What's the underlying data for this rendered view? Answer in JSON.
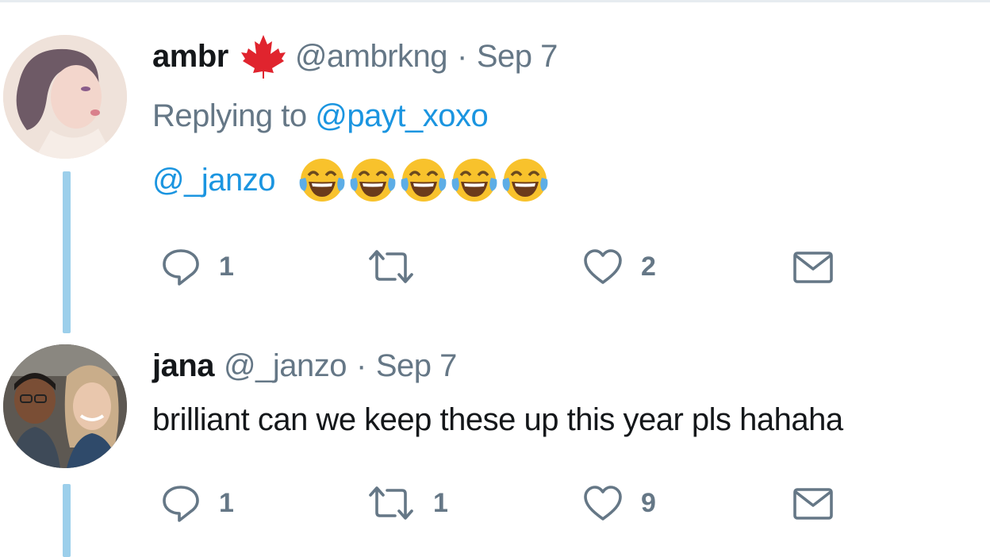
{
  "tweets": [
    {
      "name": "ambr",
      "handle": "@ambrkng",
      "separator": "·",
      "date": "Sep 7",
      "replying_prefix": "Replying to",
      "replying_to": "@payt_xoxo",
      "mention": "@_janzo",
      "emoji_count": 5,
      "counts": {
        "reply": "1",
        "retweet": "",
        "like": "2"
      }
    },
    {
      "name": "jana",
      "handle": "@_janzo",
      "separator": "·",
      "date": "Sep 7",
      "text": "brilliant can we keep these up this year pls hahaha",
      "counts": {
        "reply": "1",
        "retweet": "1",
        "like": "9"
      }
    }
  ],
  "icons": {
    "reply": "reply-icon",
    "retweet": "retweet-icon",
    "like": "heart-icon",
    "dm": "envelope-icon",
    "flag": "maple-leaf-icon",
    "emoji": "face-with-tears-of-joy-icon"
  },
  "colors": {
    "link": "#1b95e0",
    "muted": "#657786",
    "thread_line": "#9ccfeb",
    "maple_leaf": "#e0242e",
    "emoji_face": "#f8c22c",
    "emoji_tears": "#5dade6"
  }
}
